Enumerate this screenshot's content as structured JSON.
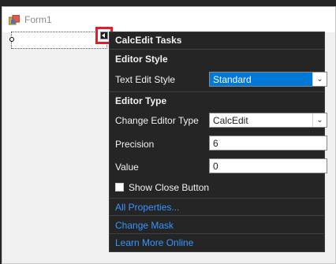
{
  "form": {
    "title": "Form1"
  },
  "panel": {
    "title": "CalcEdit Tasks",
    "editor_style": {
      "heading": "Editor Style",
      "text_edit_style_label": "Text Edit Style",
      "text_edit_style_value": "Standard"
    },
    "editor_type": {
      "heading": "Editor Type",
      "change_editor_type_label": "Change Editor Type",
      "change_editor_type_value": "CalcEdit",
      "precision_label": "Precision",
      "precision_value": "6",
      "value_label": "Value",
      "value_value": "0",
      "show_close_button_label": "Show Close Button",
      "show_close_button_checked": false
    },
    "links": {
      "all_properties": "All Properties...",
      "change_mask": "Change Mask",
      "learn_more": "Learn More Online"
    }
  },
  "colors": {
    "accent_highlight": "#e01f26",
    "selection_blue": "#0078d7",
    "link_blue": "#3794ff",
    "panel_bg": "#252526"
  }
}
